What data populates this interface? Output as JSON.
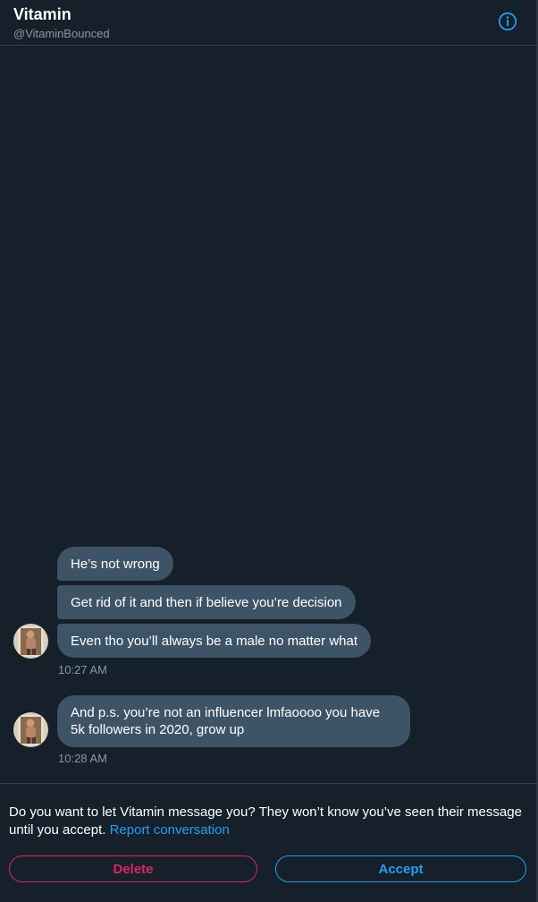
{
  "header": {
    "name": "Vitamin",
    "handle": "@VitaminBounced",
    "info_icon": "info-icon"
  },
  "messages": [
    {
      "text": "He’s not wrong"
    },
    {
      "text": "Get rid of it and then if believe you’re decision"
    },
    {
      "text": "Even tho you’ll always be a male no matter what"
    },
    {
      "text": "And p.s. you’re not an influencer lmfaoooo you have 5k followers in 2020, grow up"
    }
  ],
  "timestamps": [
    "10:27 AM",
    "10:28 AM"
  ],
  "request": {
    "prompt": "Do you want to let Vitamin message you? They won’t know you’ve seen their message until you accept. ",
    "report_label": "Report conversation",
    "delete_label": "Delete",
    "accept_label": "Accept"
  },
  "colors": {
    "background": "#15202b",
    "bubble": "#3d5466",
    "accent": "#1da1f2",
    "danger": "#e0245e",
    "secondary_text": "#8899a6"
  }
}
